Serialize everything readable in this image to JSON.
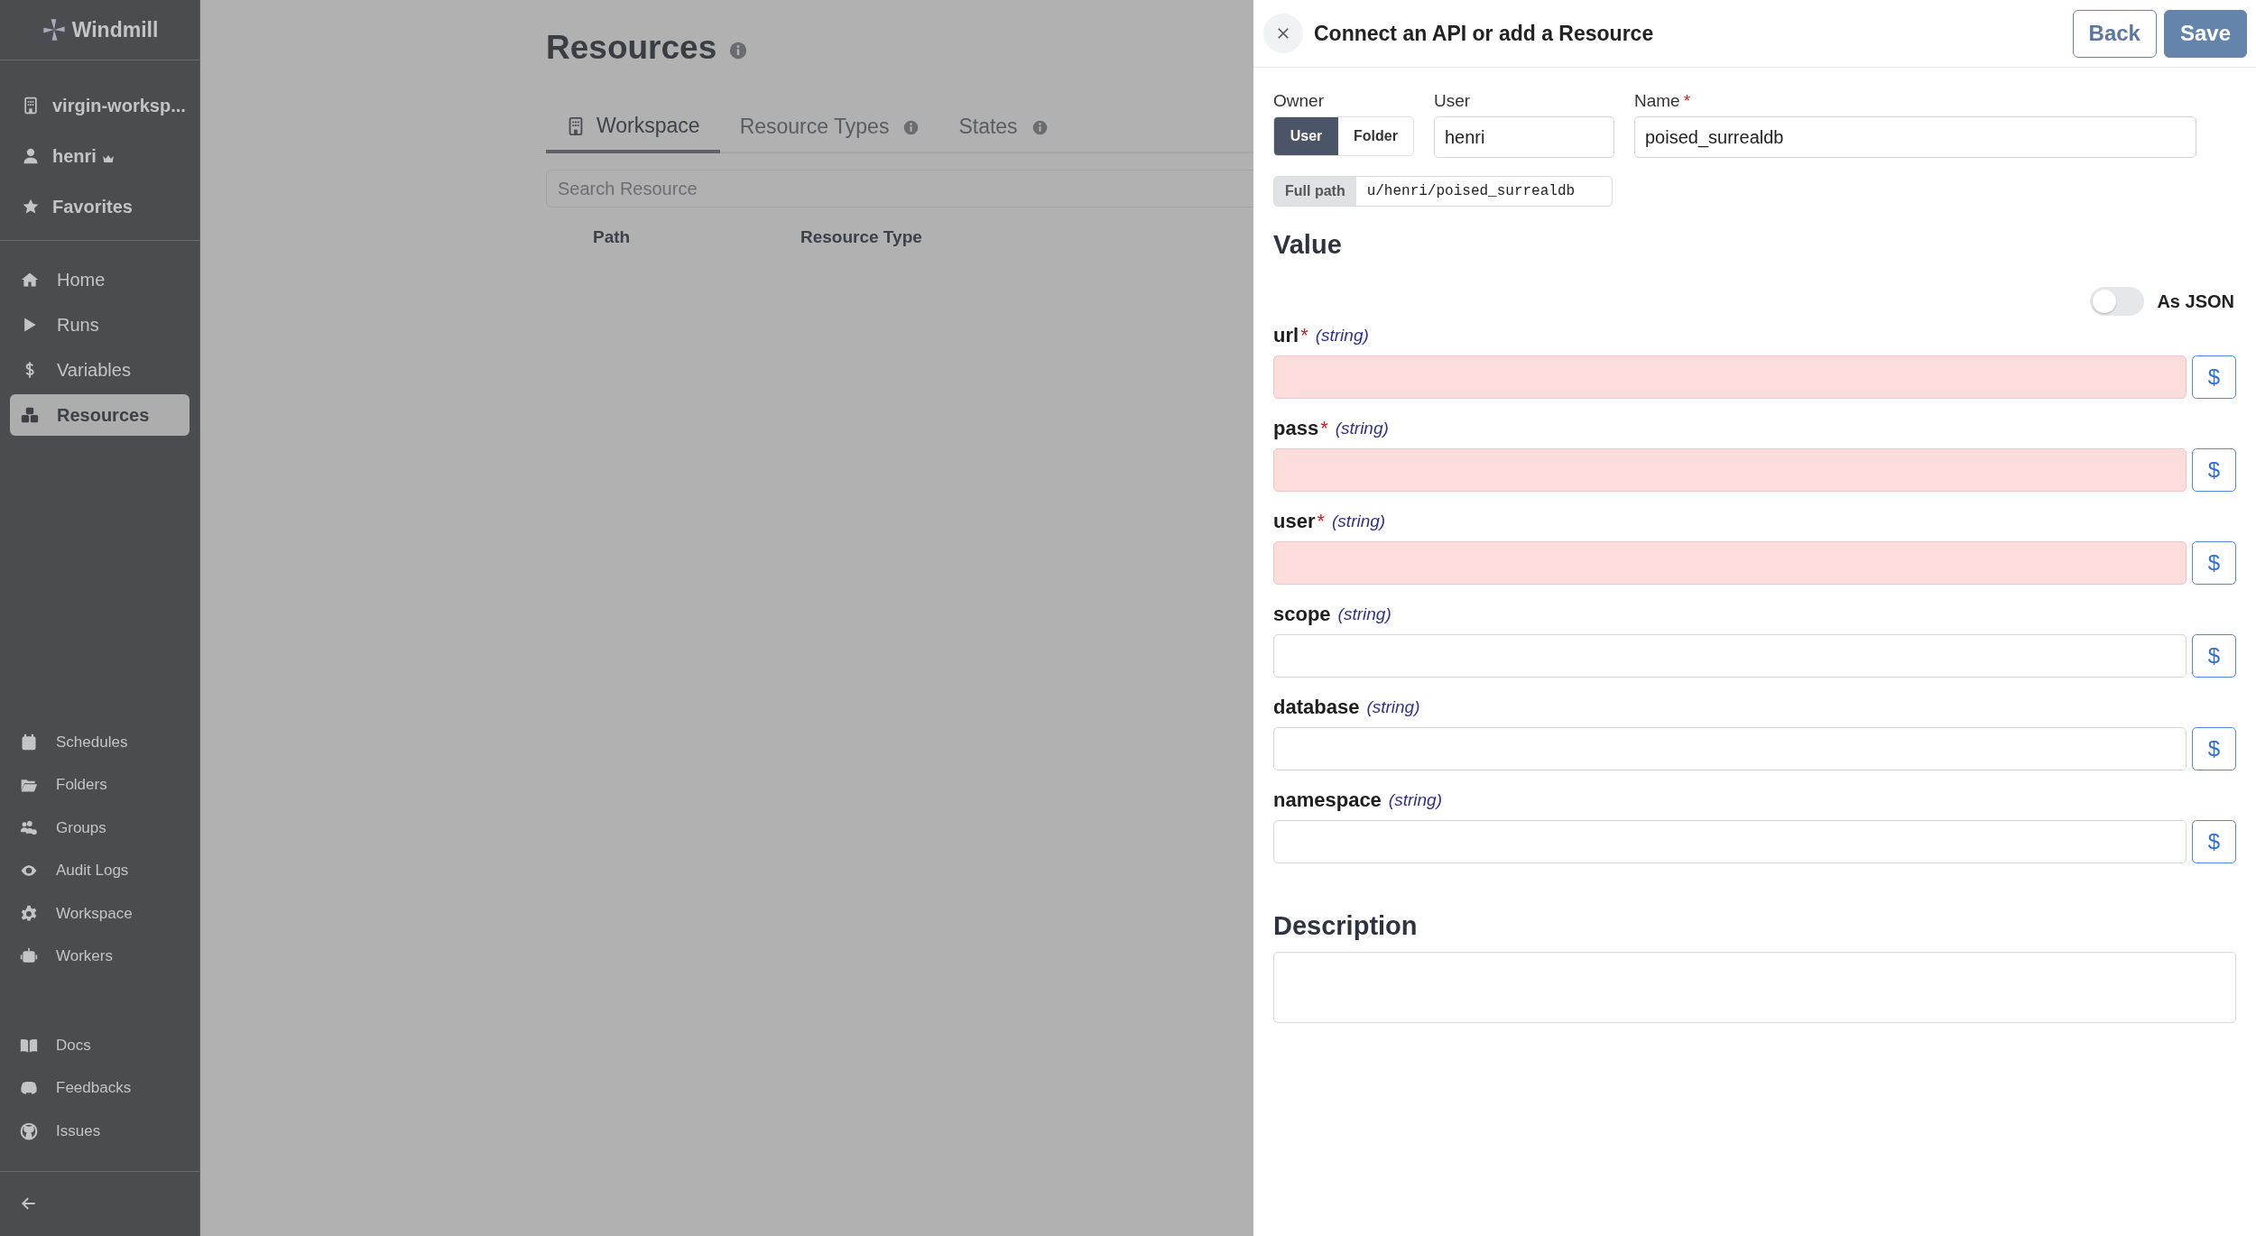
{
  "sidebar": {
    "logo": "Windmill",
    "top_items": [
      {
        "label": "virgin-worksp...",
        "admin": false
      },
      {
        "label": "henri",
        "admin": true
      },
      {
        "label": "Favorites",
        "admin": false
      }
    ],
    "nav_items": [
      {
        "label": "Home",
        "selected": false
      },
      {
        "label": "Runs",
        "selected": false
      },
      {
        "label": "Variables",
        "selected": false
      },
      {
        "label": "Resources",
        "selected": true
      }
    ],
    "secondary_items": [
      {
        "label": "Schedules"
      },
      {
        "label": "Folders"
      },
      {
        "label": "Groups"
      },
      {
        "label": "Audit Logs"
      },
      {
        "label": "Workspace"
      },
      {
        "label": "Workers"
      }
    ],
    "link_items": [
      {
        "label": "Docs"
      },
      {
        "label": "Feedbacks"
      },
      {
        "label": "Issues"
      }
    ]
  },
  "page": {
    "title": "Resources",
    "tabs": [
      {
        "label": "Workspace",
        "selected": true,
        "info": false
      },
      {
        "label": "Resource Types",
        "selected": false,
        "info": true
      },
      {
        "label": "States",
        "selected": false,
        "info": true
      }
    ],
    "search": {
      "placeholder": "Search Resource"
    },
    "table": {
      "columns": [
        "Path",
        "Resource Type"
      ]
    }
  },
  "drawer": {
    "title": "Connect an API or add a Resource",
    "buttons": [
      {
        "label": "Back",
        "kind": "outline"
      },
      {
        "label": "Save",
        "kind": "primary"
      }
    ],
    "owner": {
      "label": "Owner",
      "options": [
        {
          "label": "User",
          "selected": true
        },
        {
          "label": "Folder",
          "selected": false
        }
      ]
    },
    "user": {
      "label": "User",
      "value": "henri"
    },
    "name": {
      "label": "Name",
      "mark": "*",
      "value": "poised_surrealdb"
    },
    "full_path": {
      "label": "Full path",
      "value": "u/henri/poised_surrealdb"
    },
    "value_heading": "Value",
    "as_json": {
      "label": "As JSON",
      "on": false
    },
    "fields": [
      {
        "name": "url",
        "mark": "*",
        "type": "(string)",
        "invalid": true,
        "button": "$"
      },
      {
        "name": "pass",
        "mark": "*",
        "type": "(string)",
        "invalid": true,
        "button": "$"
      },
      {
        "name": "user",
        "mark": "*",
        "type": "(string)",
        "invalid": true,
        "button": "$"
      },
      {
        "name": "scope",
        "type": "(string)",
        "invalid": false,
        "button": "$"
      },
      {
        "name": "database",
        "type": "(string)",
        "invalid": false,
        "button": "$"
      },
      {
        "name": "namespace",
        "type": "(string)",
        "invalid": false,
        "button": "$"
      }
    ],
    "description_heading": "Description"
  }
}
